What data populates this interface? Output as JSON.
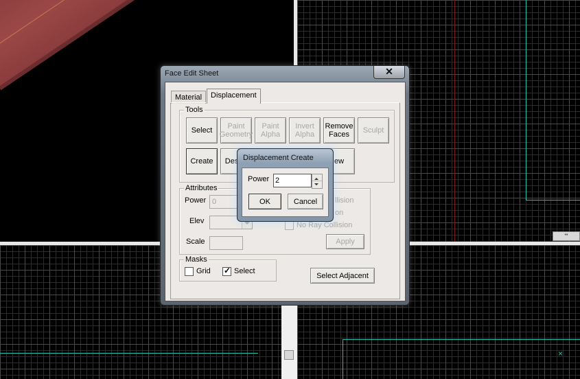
{
  "face_edit_sheet": {
    "title": "Face Edit Sheet",
    "close_label": "✕",
    "tabs": [
      {
        "label": "Material",
        "active": false
      },
      {
        "label": "Displacement",
        "active": true
      }
    ],
    "tools": {
      "label": "Tools",
      "buttons": [
        {
          "label": "Select",
          "enabled": true
        },
        {
          "label": "Paint Geometry",
          "enabled": false
        },
        {
          "label": "Paint Alpha",
          "enabled": false
        },
        {
          "label": "Invert Alpha",
          "enabled": false
        },
        {
          "label": "Remove Faces",
          "enabled": true
        },
        {
          "label": "Sculpt",
          "enabled": false
        },
        {
          "label": "Create",
          "enabled": true
        },
        {
          "label": "Destro",
          "enabled": true
        },
        {
          "label": "ew",
          "enabled": true
        }
      ]
    },
    "attributes": {
      "label": "Attributes",
      "power_label": "Power",
      "power_value": "0",
      "elev_label": "Elev",
      "scale_label": "Scale",
      "checkboxes": [
        "llision",
        "on",
        "No Ray Collision"
      ],
      "apply_label": "Apply"
    },
    "masks": {
      "label": "Masks",
      "grid": {
        "label": "Grid",
        "checked": false
      },
      "select": {
        "label": "Select",
        "checked": true
      }
    },
    "select_adjacent_label": "Select Adjacent"
  },
  "displacement_create": {
    "title": "Displacement Create",
    "power_label": "Power",
    "power_value": "2",
    "ok_label": "OK",
    "cancel_label": "Cancel"
  },
  "scrollbar_glyph": "'''",
  "colors": {
    "grid_line": "#3a3a3a",
    "axis_cyan": "#1fc4b2",
    "road": "#8e3f3f"
  }
}
